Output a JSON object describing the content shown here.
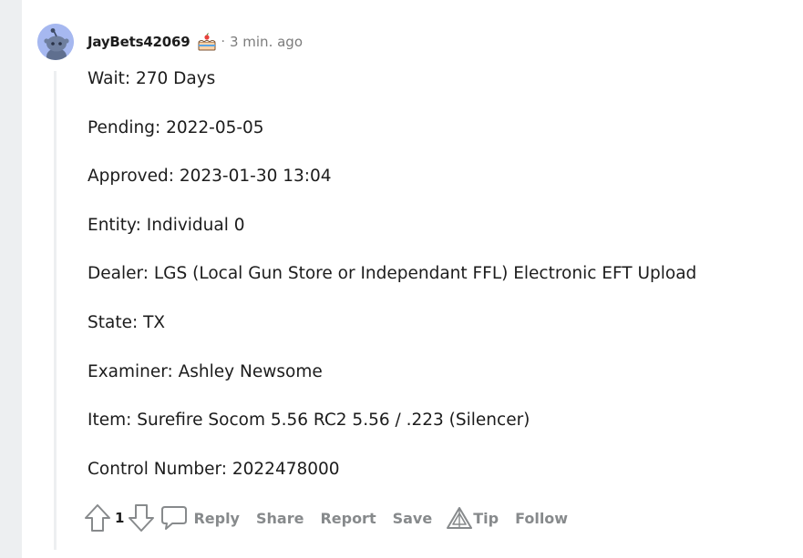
{
  "comment": {
    "username": "JayBets42069",
    "separator": "·",
    "time": "3 min. ago",
    "lines": [
      "Wait: 270 Days",
      "Pending: 2022-05-05",
      "Approved: 2023-01-30 13:04",
      "Entity: Individual 0",
      "Dealer: LGS (Local Gun Store or Independant FFL) Electronic EFT Upload",
      "State: TX",
      "Examiner: Ashley Newsome",
      "Item: Surefire Socom 5.56 RC2 5.56 / .223 (Silencer)",
      "Control Number: 2022478000"
    ]
  },
  "actions": {
    "vote_count": "1",
    "reply": "Reply",
    "share": "Share",
    "report": "Report",
    "save": "Save",
    "tip": "Tip",
    "follow": "Follow"
  },
  "icons": {
    "upvote": "arrow-up-icon",
    "downvote": "arrow-down-icon",
    "reply": "speech-bubble-icon",
    "tip": "triangle-tip-icon",
    "cake": "cake-day-icon"
  },
  "colors": {
    "gutter": "#edeff1",
    "avatar_bg": "#a6b8f0",
    "muted": "#878a8c",
    "text": "#1c1c1c"
  }
}
